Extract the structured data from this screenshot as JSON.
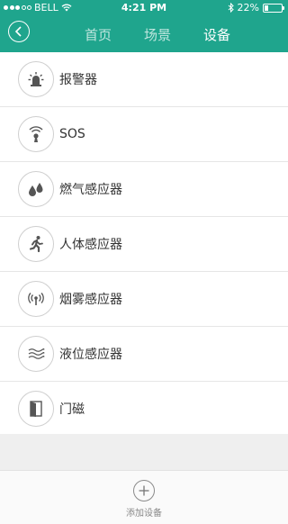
{
  "status_bar": {
    "carrier": "BELL",
    "time": "4:21 PM",
    "battery_text": "22%",
    "battery_level": 0.22
  },
  "nav": {
    "tabs": [
      {
        "label": "首页",
        "active": false
      },
      {
        "label": "场景",
        "active": false
      },
      {
        "label": "设备",
        "active": true
      }
    ]
  },
  "devices": [
    {
      "label": "报警器",
      "icon": "alarm-siren-icon"
    },
    {
      "label": "SOS",
      "icon": "sos-icon"
    },
    {
      "label": "燃气感应器",
      "icon": "gas-drops-icon"
    },
    {
      "label": "人体感应器",
      "icon": "running-person-icon"
    },
    {
      "label": "烟雾感应器",
      "icon": "smoke-signal-icon"
    },
    {
      "label": "液位感应器",
      "icon": "water-level-icon"
    },
    {
      "label": "门磁",
      "icon": "door-icon"
    }
  ],
  "footer": {
    "add_label": "添加设备"
  },
  "colors": {
    "accent": "#1fa58d",
    "icon_gray": "#555555"
  }
}
